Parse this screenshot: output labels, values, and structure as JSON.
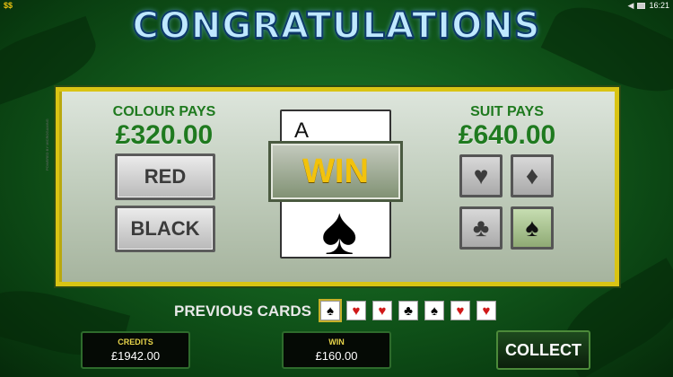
{
  "title": "CONGRATULATIONS",
  "status_bar": {
    "time": "16:21",
    "coin_icon": "coin-stack-icon",
    "volume_icon": "speaker-icon",
    "battery_icon": "battery-icon"
  },
  "side_caption": "POWERED BY MICROGAMING",
  "colour": {
    "label": "COLOUR PAYS",
    "value": "£320.00",
    "buttons": [
      "RED",
      "BLACK"
    ]
  },
  "suit": {
    "label": "SUIT PAYS",
    "value": "£640.00",
    "buttons": [
      {
        "symbol": "♥",
        "name": "hearts",
        "selected": false
      },
      {
        "symbol": "♦",
        "name": "diamonds",
        "selected": false
      },
      {
        "symbol": "♣",
        "name": "clubs",
        "selected": false
      },
      {
        "symbol": "♠",
        "name": "spades",
        "selected": true
      }
    ]
  },
  "card": {
    "rank": "A",
    "suit": "♠"
  },
  "win_banner": "WIN",
  "previous_cards": {
    "label": "PREVIOUS CARDS",
    "cards": [
      {
        "suit": "♠",
        "color": "#000000"
      },
      {
        "suit": "♥",
        "color": "#d01818"
      },
      {
        "suit": "♥",
        "color": "#d01818"
      },
      {
        "suit": "♣",
        "color": "#000000"
      },
      {
        "suit": "♠",
        "color": "#000000"
      },
      {
        "suit": "♥",
        "color": "#d01818"
      },
      {
        "suit": "♥",
        "color": "#d01818"
      }
    ]
  },
  "credits": {
    "label": "CREDITS",
    "value": "£1942.00"
  },
  "win": {
    "label": "WIN",
    "value": "£160.00"
  },
  "collect_label": "COLLECT",
  "colors": {
    "panel_border": "#d9c414",
    "pays_text": "#1f7a1f",
    "win_text": "#f2c20c",
    "title_fill": "#bfe8ff"
  }
}
